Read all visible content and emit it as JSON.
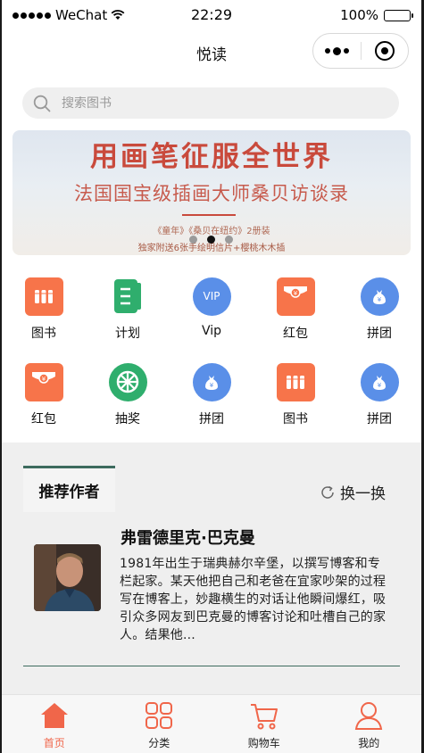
{
  "status_bar": {
    "carrier": "WeChat",
    "time": "22:29",
    "battery": "100%"
  },
  "navbar": {
    "title": "悦读"
  },
  "search": {
    "placeholder": "搜索图书"
  },
  "banner": {
    "line1": "用画笔征服全世界",
    "line2": "法国国宝级插画大师桑贝访谈录",
    "line3": "《童年》《桑贝在纽约》2册装",
    "line4": "独家附送6张手绘明信片+樱桃木木插",
    "slide_count": 3,
    "active_slide": 2
  },
  "grid": {
    "row1": [
      {
        "label": "图书",
        "icon": "books-icon"
      },
      {
        "label": "计划",
        "icon": "plan-icon"
      },
      {
        "label": "Vip",
        "icon": "vip-icon"
      },
      {
        "label": "红包",
        "icon": "red-packet-icon"
      },
      {
        "label": "拼团",
        "icon": "group-buy-icon"
      }
    ],
    "row2": [
      {
        "label": "红包",
        "icon": "red-packet-icon"
      },
      {
        "label": "抽奖",
        "icon": "lottery-icon"
      },
      {
        "label": "拼团",
        "icon": "group-buy-icon"
      },
      {
        "label": "图书",
        "icon": "books-icon"
      },
      {
        "label": "拼团",
        "icon": "group-buy-icon"
      }
    ]
  },
  "recommend": {
    "tab_label": "推荐作者",
    "refresh_label": "换一换",
    "author_name": "弗雷德里克·巴克曼",
    "author_desc": "1981年出生于瑞典赫尔辛堡，以撰写博客和专栏起家。某天他把自己和老爸在宜家吵架的过程写在博客上，妙趣横生的对话让他瞬间爆红，吸引众多网友到巴克曼的博客讨论和吐槽自己的家人。结果他..."
  },
  "tabbar": {
    "items": [
      {
        "label": "首页",
        "icon": "home-icon",
        "active": true
      },
      {
        "label": "分类",
        "icon": "category-icon",
        "active": false
      },
      {
        "label": "购物车",
        "icon": "cart-icon",
        "active": false
      },
      {
        "label": "我的",
        "icon": "profile-icon",
        "active": false
      }
    ]
  },
  "colors": {
    "accent": "#f0664a",
    "orange_tile": "#f7744a",
    "blue_tile": "#5a8fe8",
    "green_tile": "#2fae6d",
    "section_rule": "#3d6b5e"
  }
}
